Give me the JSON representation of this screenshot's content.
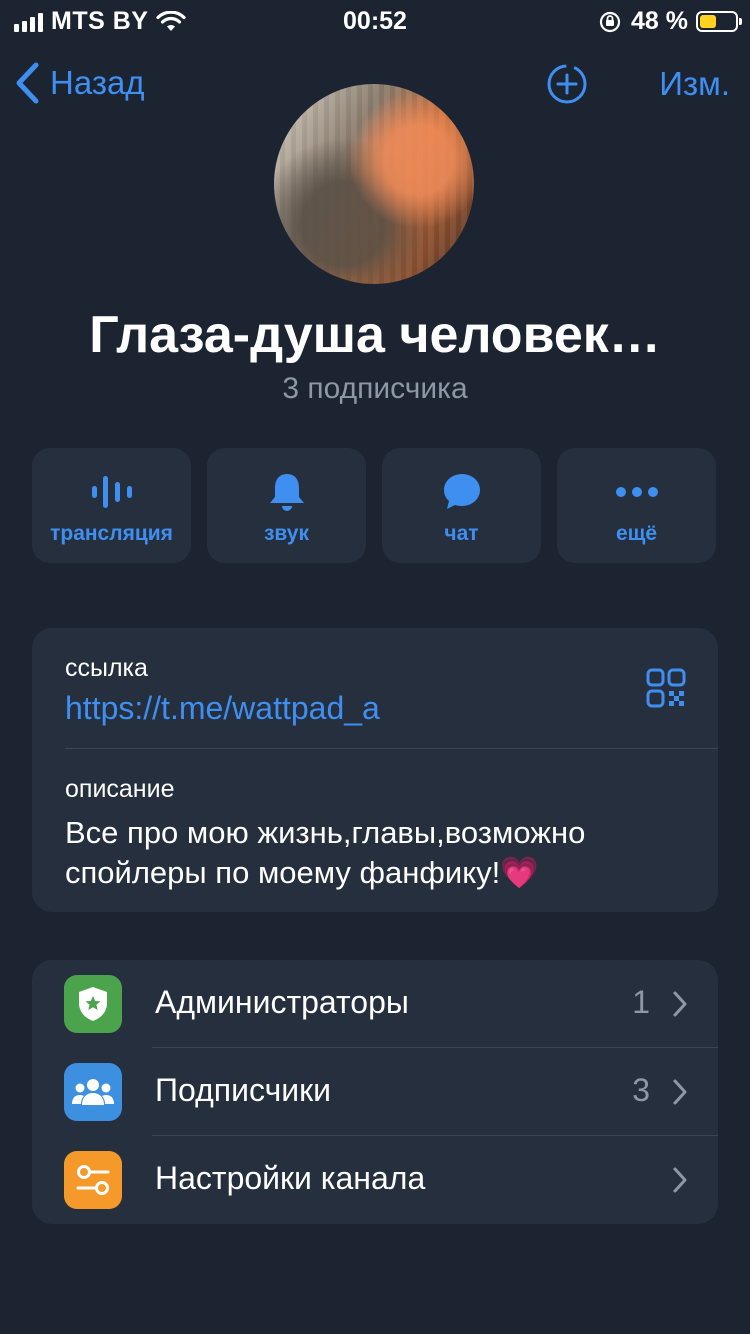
{
  "status_bar": {
    "carrier": "MTS BY",
    "time": "00:52",
    "battery_percent": "48 %",
    "battery_level": 0.48
  },
  "nav": {
    "back_label": "Назад",
    "edit_label": "Изм."
  },
  "channel": {
    "title": "Глаза-душа человек…",
    "subscribers": "3 подписчика"
  },
  "actions": [
    {
      "label": "трансляция",
      "icon": "waveform-icon"
    },
    {
      "label": "звук",
      "icon": "bell-icon"
    },
    {
      "label": "чат",
      "icon": "chat-bubble-icon"
    },
    {
      "label": "ещё",
      "icon": "more-dots-icon"
    }
  ],
  "info": {
    "link_label": "ссылка",
    "link_value": "https://t.me/wattpad_a",
    "description_label": "описание",
    "description_text": "Все про мою жизнь,главы,возможно спойлеры по моему фанфику!",
    "description_emoji": "💗"
  },
  "menu": [
    {
      "label": "Администраторы",
      "count": "1",
      "icon": "shield-star-icon",
      "color": "#4ba34b"
    },
    {
      "label": "Подписчики",
      "count": "3",
      "icon": "people-icon",
      "color": "#3d8fe0"
    },
    {
      "label": "Настройки канала",
      "count": "",
      "icon": "sliders-icon",
      "color": "#f59a2a"
    }
  ],
  "colors": {
    "background": "#1c2431",
    "card": "#252f3e",
    "accent": "#3f8ff1",
    "secondary_text": "#8d97a5"
  }
}
